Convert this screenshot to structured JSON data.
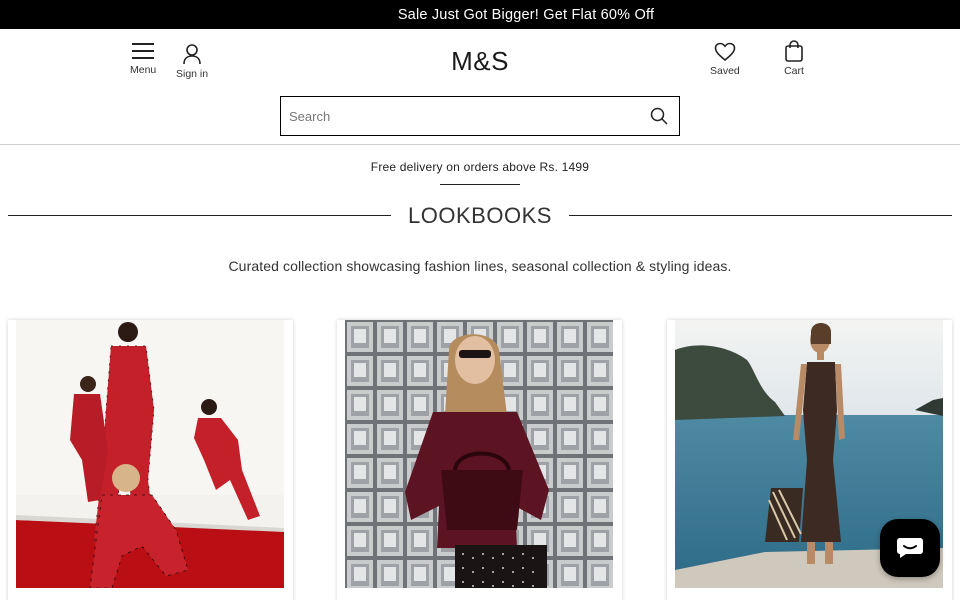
{
  "promo_bar": {
    "text": "Sale Just Got Bigger! Get Flat 60% Off"
  },
  "header": {
    "menu_label": "Menu",
    "signin_label": "Sign in",
    "logo_text": "M&S",
    "saved_label": "Saved",
    "cart_label": "Cart",
    "search_placeholder": "Search"
  },
  "delivery_banner": {
    "text": "Free delivery on orders above Rs. 1499"
  },
  "lookbooks": {
    "title": "LOOKBOOKS",
    "subtitle": "Curated collection showcasing fashion lines, seasonal collection & styling ideas."
  },
  "cards": [
    {
      "name": "family-pyjamas-lookbook"
    },
    {
      "name": "burgundy-knitwear-lookbook"
    },
    {
      "name": "seaside-dress-lookbook"
    }
  ],
  "colors": {
    "promo_bg": "#000000",
    "accent": "#000000",
    "card1_floor": "#b90f14",
    "card3_sea": "#3f7e98"
  }
}
